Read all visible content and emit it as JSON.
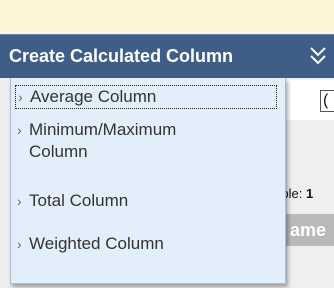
{
  "header": {
    "title": "Create Calculated Column",
    "chevron_icon": "double-chevron-down-icon"
  },
  "menu": {
    "items": [
      {
        "label": "Average Column",
        "icon": "chevron-right-icon"
      },
      {
        "label": "Minimum/Maximum Column",
        "icon": "chevron-right-icon"
      },
      {
        "label": "Total Column",
        "icon": "chevron-right-icon"
      },
      {
        "label": "Weighted Column",
        "icon": "chevron-right-icon"
      }
    ],
    "chevron_glyph": "›"
  },
  "background": {
    "input_value": "(",
    "visible_label": "sible: ",
    "visible_count": "1",
    "column_header": "ame"
  },
  "colors": {
    "header_bg": "#3f5e87",
    "dropdown_bg": "#e3eefb",
    "top_band": "#fdf4d6"
  }
}
